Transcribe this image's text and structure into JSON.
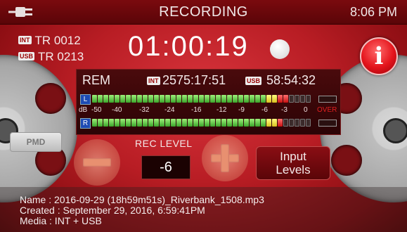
{
  "header": {
    "title": "RECORDING",
    "time": "8:06 PM"
  },
  "tracks": {
    "int_badge": "INT",
    "int_track": "TR 0012",
    "usb_badge": "USB",
    "usb_track": "TR 0213"
  },
  "timecode": "01:00:19",
  "info_button_label": "i",
  "remaining": {
    "label": "REM",
    "int_badge": "INT",
    "int_time": "2575:17:51",
    "usb_badge": "USB",
    "usb_time": "58:54:32"
  },
  "meters": {
    "left_label": "L",
    "right_label": "R",
    "db_label": "dB",
    "scale": [
      "-50",
      "-40",
      "-32",
      "-24",
      "-16",
      "-12",
      "-9",
      "-6",
      "-3",
      "0"
    ],
    "over_label": "OVER",
    "left_level_segments": 35,
    "right_level_segments": 34,
    "total_segments": 39
  },
  "rec_level": {
    "label": "REC LEVEL",
    "value": "-6"
  },
  "input_levels_button": {
    "line1": "Input",
    "line2": "Levels"
  },
  "reel_label": "PMD",
  "file": {
    "name_line": "Name : 2016-09-29 (18h59m51s)_Riverbank_1508.mp3",
    "created_line": "Created : September 29, 2016, 6:59:41PM",
    "media_line": "Media : INT + USB"
  },
  "colors": {
    "background": "#b81d24",
    "meter_green": "#3aa52a",
    "meter_yellow": "#d8c020",
    "meter_red": "#c81010",
    "channel_badge": "#1d4bb4"
  }
}
